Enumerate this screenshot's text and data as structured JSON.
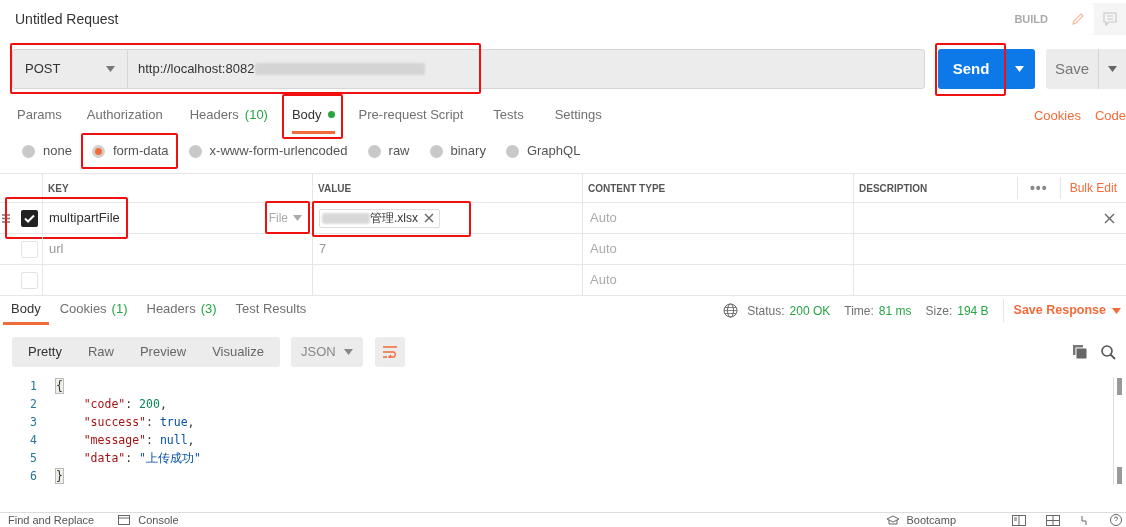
{
  "title": "Untitled Request",
  "mode_label": "BUILD",
  "request": {
    "method": "POST",
    "url": "http://localhost:8082",
    "url_redacted": true,
    "highlighted": true
  },
  "send": {
    "label": "Send",
    "highlighted": true
  },
  "save": {
    "label": "Save"
  },
  "request_tabs": [
    {
      "label": "Params",
      "selected": false
    },
    {
      "label": "Authorization",
      "selected": false
    },
    {
      "label": "Headers",
      "count": "(10)",
      "selected": false
    },
    {
      "label": "Body",
      "modified": true,
      "selected": true,
      "highlighted": true
    },
    {
      "label": "Pre-request Script",
      "selected": false
    },
    {
      "label": "Tests",
      "selected": false
    },
    {
      "label": "Settings",
      "selected": false
    }
  ],
  "request_links": [
    "Cookies",
    "Code"
  ],
  "body_types": [
    {
      "label": "none",
      "selected": false
    },
    {
      "label": "form-data",
      "selected": true,
      "highlighted": true
    },
    {
      "label": "x-www-form-urlencoded",
      "selected": false
    },
    {
      "label": "raw",
      "selected": false
    },
    {
      "label": "binary",
      "selected": false
    },
    {
      "label": "GraphQL",
      "selected": false
    }
  ],
  "table": {
    "columns": [
      "KEY",
      "VALUE",
      "CONTENT TYPE",
      "DESCRIPTION"
    ],
    "more": "•••",
    "bulk_edit": "Bulk Edit",
    "rows": [
      {
        "checked": true,
        "key": "multipartFile",
        "key_highlighted": true,
        "type": "File",
        "type_highlighted": true,
        "kind": "file",
        "value": "管理.xlsx",
        "value_redacted": true,
        "value_highlighted": true,
        "content_type": "Auto",
        "deletable": true
      },
      {
        "checked": false,
        "key": "url",
        "kind": "text",
        "value": "7",
        "content_type": "Auto"
      },
      {
        "checked": false,
        "kind": "text",
        "content_type": "Auto"
      }
    ]
  },
  "response_tabs": [
    {
      "label": "Body",
      "selected": true
    },
    {
      "label": "Cookies",
      "count": "(1)",
      "selected": false
    },
    {
      "label": "Headers",
      "count": "(3)",
      "selected": false
    },
    {
      "label": "Test Results",
      "selected": false
    }
  ],
  "response_meta": [
    {
      "label": "Status:",
      "value": "200 OK"
    },
    {
      "label": "Time:",
      "value": "81 ms"
    },
    {
      "label": "Size:",
      "value": "194 B"
    }
  ],
  "save_response": "Save Response",
  "view_modes": [
    {
      "label": "Pretty",
      "selected": true
    },
    {
      "label": "Raw",
      "selected": false
    },
    {
      "label": "Preview",
      "selected": false
    },
    {
      "label": "Visualize",
      "selected": false
    }
  ],
  "format": "JSON",
  "code_lines": [
    {
      "number": "1",
      "tokens": [
        {
          "kind": "bracket",
          "text": "{"
        }
      ]
    },
    {
      "number": "2",
      "tokens": [
        {
          "kind": "key",
          "text": "    \"code\""
        },
        {
          "kind": "plain",
          "text": ": "
        },
        {
          "kind": "number",
          "text": "200"
        },
        {
          "kind": "plain",
          "text": ","
        }
      ]
    },
    {
      "number": "3",
      "tokens": [
        {
          "kind": "key",
          "text": "    \"success\""
        },
        {
          "kind": "plain",
          "text": ": "
        },
        {
          "kind": "literal",
          "text": "true"
        },
        {
          "kind": "plain",
          "text": ","
        }
      ]
    },
    {
      "number": "4",
      "tokens": [
        {
          "kind": "key",
          "text": "    \"message\""
        },
        {
          "kind": "plain",
          "text": ": "
        },
        {
          "kind": "literal",
          "text": "null"
        },
        {
          "kind": "plain",
          "text": ","
        }
      ]
    },
    {
      "number": "5",
      "tokens": [
        {
          "kind": "key",
          "text": "    \"data\""
        },
        {
          "kind": "plain",
          "text": ": "
        },
        {
          "kind": "string",
          "text": "\"上传成功\""
        }
      ]
    },
    {
      "number": "6",
      "tokens": [
        {
          "kind": "bracket",
          "text": "}"
        }
      ]
    }
  ],
  "status_bar": {
    "left": [
      "Find and Replace",
      "Console"
    ],
    "right": "Bootcamp"
  }
}
